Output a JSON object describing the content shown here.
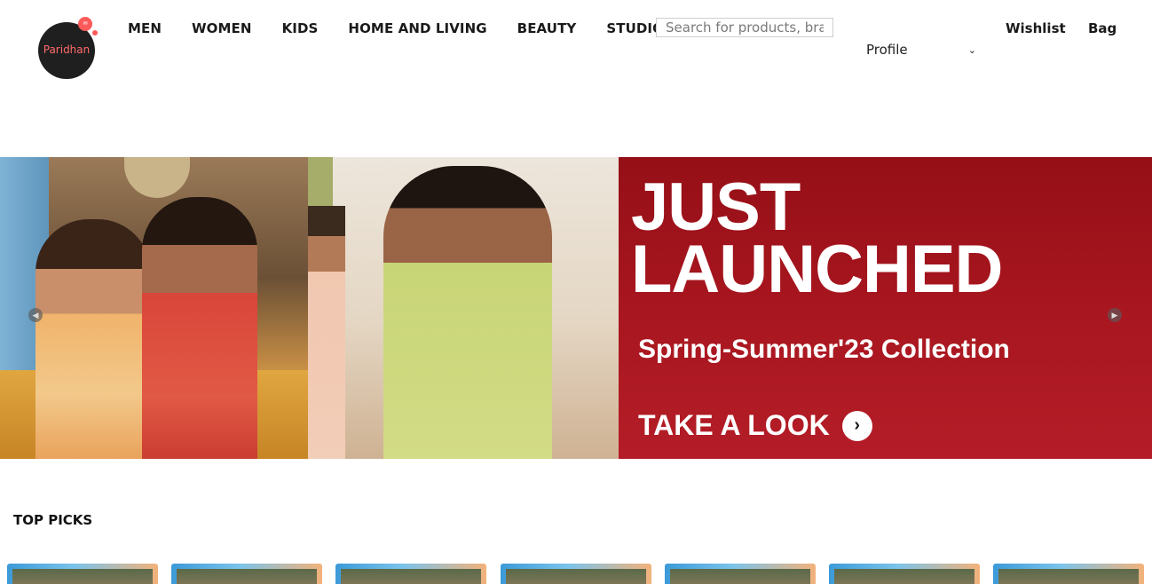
{
  "header": {
    "logo_text": "Paridhan",
    "nav": [
      "MEN",
      "WOMEN",
      "KIDS",
      "HOME AND LIVING",
      "BEAUTY",
      "STUDIO"
    ],
    "search_placeholder": "Search for products, brands and more",
    "profile_label": "Profile",
    "wishlist_label": "Wishlist",
    "bag_label": "Bag"
  },
  "banner": {
    "headline_line1": "JUST",
    "headline_line2": "LAUNCHED",
    "subtitle": "Spring-Summer'23 Collection",
    "cta_label": "TAKE A LOOK",
    "accent_color": "#a8161f"
  },
  "top_picks": {
    "title": "TOP PICKS",
    "count": 7
  }
}
